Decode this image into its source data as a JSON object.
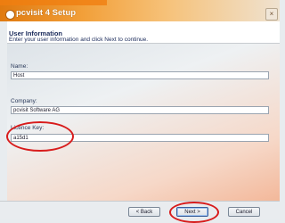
{
  "window": {
    "title": "pcvisit 4 Setup",
    "close_glyph": "×"
  },
  "header": {
    "title": "User Information",
    "subtitle": "Enter your user information and click Next to continue."
  },
  "form": {
    "name": {
      "label": "Name:",
      "value": "Host"
    },
    "company": {
      "label": "Company:",
      "value": "pcvisit Software AG"
    },
    "licence": {
      "label": "Licence Key:",
      "value": "a15d1"
    }
  },
  "buttons": {
    "back": "< Back",
    "next": "Next >",
    "cancel": "Cancel"
  },
  "colors": {
    "accent": "#f07e10",
    "highlight": "#d81c1c"
  }
}
